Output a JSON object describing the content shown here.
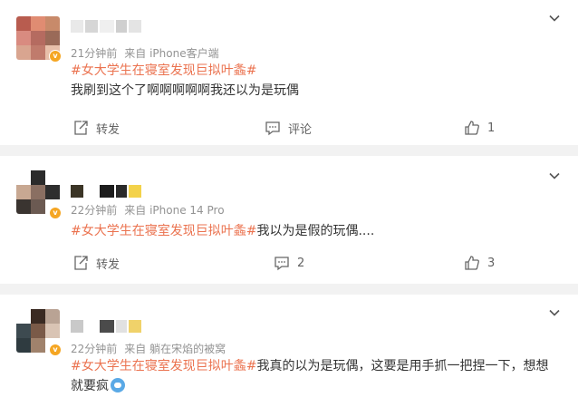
{
  "comments": [
    {
      "avatar_colors": [
        "#b85c4f",
        "#e08c72",
        "#c88a6a",
        "#d98b80",
        "#b56b60",
        "#9a6a58",
        "#d9a590",
        "#c07b6c",
        "#e8c0aa"
      ],
      "nick_colors": [
        "#e9e9e9",
        "#d6d6d6",
        "#efefef",
        "#cfcfcf",
        "#e4e4e4"
      ],
      "time": "21分钟前",
      "source": "来自 iPhone客户端",
      "hashtag": "#女大学生在寝室发现巨拟叶螽#",
      "body": "我刷到这个了啊啊啊啊啊我还以为是玩偶",
      "share_label": "转发",
      "comment_label": "评论",
      "like_count": "1"
    },
    {
      "avatar_colors": [
        "#ffffff",
        "#2b2b2b",
        "#ffffff",
        "#c8a892",
        "#8a6f62",
        "#2e2e2e",
        "#3a3430",
        "#6b5a52",
        "#ffffff"
      ],
      "nick_colors": [
        "#3b3526",
        "#ffffff",
        "#1d1d1d",
        "#2a2a2a",
        "#f3d24a"
      ],
      "time": "22分钟前",
      "source": "来自 iPhone 14 Pro",
      "hashtag": "#女大学生在寝室发现巨拟叶螽#",
      "body": "我以为是假的玩偶....",
      "share_label": "转发",
      "comment_count": "2",
      "like_count": "3"
    },
    {
      "avatar_colors": [
        "#ffffff",
        "#3a2a22",
        "#b9a394",
        "#3d4a50",
        "#7a5a48",
        "#d9c4b4",
        "#2f3b40",
        "#a0826c",
        "#ffffff"
      ],
      "nick_colors": [
        "#c9c9c9",
        "#ffffff",
        "#4b4b4b",
        "#e1e1e1",
        "#f0d26a"
      ],
      "time": "22分钟前",
      "source": "来自 躺在宋焰的被窝",
      "hashtag": "#女大学生在寝室发现巨拟叶螽#",
      "body": "我真的以为是玩偶，这要是用手抓一把捏一下，想想就要疯"
    }
  ],
  "colors": {
    "hashtag": "#eb7350",
    "meta": "#939393",
    "badge": "#f5a623"
  },
  "icons": {
    "verified": "v-badge-icon",
    "menu": "chevron-down-icon",
    "share": "share-icon",
    "comment": "comment-icon",
    "like": "thumb-up-icon",
    "emoji": "emoji-icon"
  }
}
